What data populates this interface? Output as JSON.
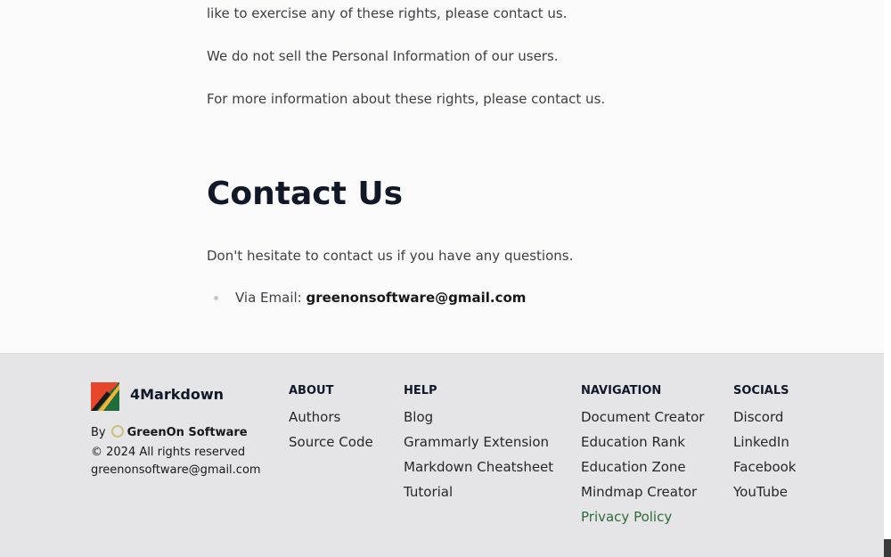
{
  "content": {
    "paragraphs": [
      "like to exercise any of these rights, please contact us.",
      "We do not sell the Personal Information of our users.",
      "For more information about these rights, please contact us."
    ],
    "contact_heading": "Contact Us",
    "contact_text": "Don't hesitate to contact us if you have any questions.",
    "email_label": "Via Email: ",
    "email_value": "greenonsoftware@gmail.com"
  },
  "footer": {
    "brand": "4Markdown",
    "by_label": "By",
    "company": "GreenOn Software",
    "copyright": "© 2024 All rights reserved",
    "email": "greenonsoftware@gmail.com",
    "columns": [
      {
        "heading": "ABOUT",
        "links": [
          "Authors",
          "Source Code"
        ]
      },
      {
        "heading": "HELP",
        "links": [
          "Blog",
          "Grammarly Extension",
          "Markdown Cheatsheet",
          "Tutorial"
        ]
      },
      {
        "heading": "NAVIGATION",
        "links": [
          "Document Creator",
          "Education Rank",
          "Education Zone",
          "Mindmap Creator",
          "Privacy Policy"
        ]
      },
      {
        "heading": "SOCIALS",
        "links": [
          "Discord",
          "LinkedIn",
          "Facebook",
          "YouTube"
        ]
      }
    ],
    "logo_colors": [
      "#e8462a",
      "#f2b33a",
      "#1f6b3a"
    ],
    "active_link_color": "#2f6a3a"
  }
}
